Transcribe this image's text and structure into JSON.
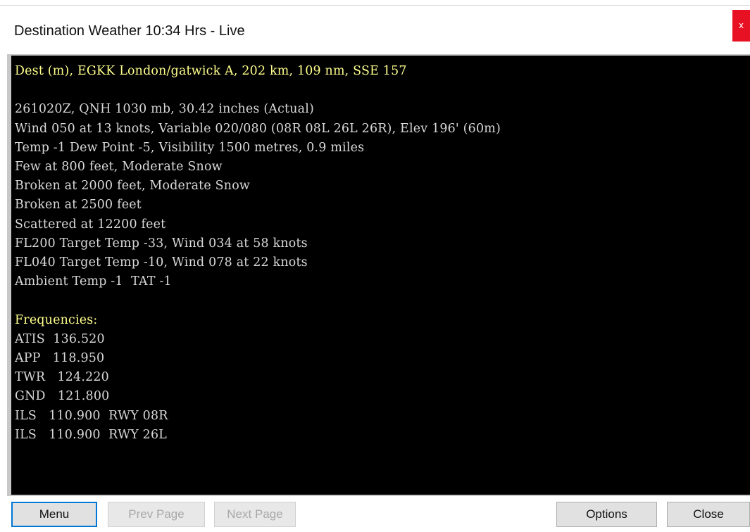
{
  "window": {
    "title": "Destination Weather 10:34 Hrs - Live",
    "close_glyph": "x"
  },
  "console_lines": [
    {
      "text": "Dest (m), EGKK London/gatwick A, 202 km, 109 nm, SSE 157",
      "highlight": true
    },
    {
      "text": "",
      "highlight": false
    },
    {
      "text": "261020Z, QNH 1030 mb, 30.42 inches (Actual)",
      "highlight": false
    },
    {
      "text": "Wind 050 at 13 knots, Variable 020/080 (08R 08L 26L 26R), Elev 196' (60m)",
      "highlight": false
    },
    {
      "text": "Temp -1 Dew Point -5, Visibility 1500 metres, 0.9 miles",
      "highlight": false
    },
    {
      "text": "Few at 800 feet, Moderate Snow",
      "highlight": false
    },
    {
      "text": "Broken at 2000 feet, Moderate Snow",
      "highlight": false
    },
    {
      "text": "Broken at 2500 feet",
      "highlight": false
    },
    {
      "text": "Scattered at 12200 feet",
      "highlight": false
    },
    {
      "text": "FL200 Target Temp -33, Wind 034 at 58 knots",
      "highlight": false
    },
    {
      "text": "FL040 Target Temp -10, Wind 078 at 22 knots",
      "highlight": false
    },
    {
      "text": "Ambient Temp -1  TAT -1",
      "highlight": false
    },
    {
      "text": "",
      "highlight": false
    },
    {
      "text": "Frequencies:",
      "highlight": true
    },
    {
      "text": "ATIS  136.520",
      "highlight": false
    },
    {
      "text": "APP   118.950",
      "highlight": false
    },
    {
      "text": "TWR   124.220",
      "highlight": false
    },
    {
      "text": "GND   121.800",
      "highlight": false
    },
    {
      "text": "ILS   110.900  RWY 08R",
      "highlight": false
    },
    {
      "text": "ILS   110.900  RWY 26L",
      "highlight": false
    }
  ],
  "buttons": {
    "menu": "Menu",
    "prev_page": "Prev Page",
    "next_page": "Next Page",
    "options": "Options",
    "close": "Close"
  },
  "colors": {
    "console_background": "#000000",
    "console_text": "#d8d8d8",
    "console_highlight": "#ffff8c",
    "close_button": "#e81123",
    "default_button_border": "#0078d7"
  }
}
